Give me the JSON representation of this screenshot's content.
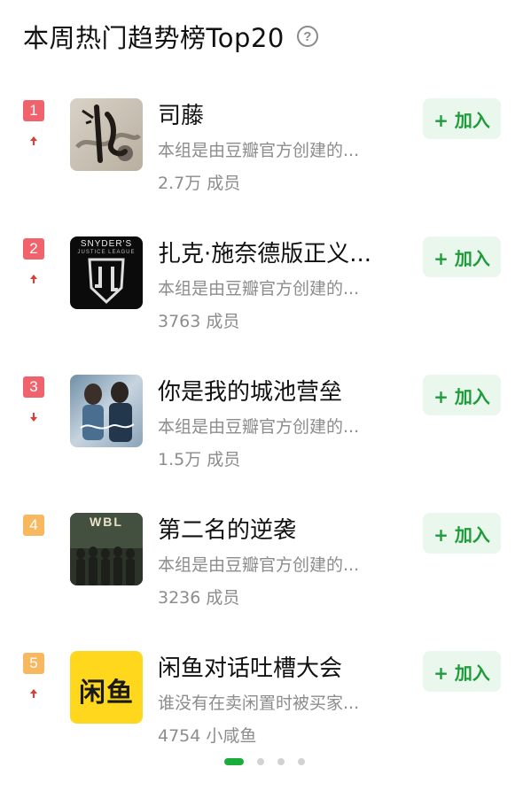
{
  "header": {
    "title": "本周热门趋势榜Top20",
    "help_glyph": "?"
  },
  "groups": [
    {
      "rank": "1",
      "rank_color": "#f0636d",
      "trend": "up",
      "thumbnail": "siteng-poster",
      "name": "司藤",
      "description": "本组是由豆瓣官方创建的...",
      "members": "2.7万 成员",
      "join_label": "+ 加入"
    },
    {
      "rank": "2",
      "rank_color": "#f0636d",
      "trend": "up",
      "thumbnail": "snyder-justice-league-logo",
      "thumb_text_top": "SNYDER'S",
      "thumb_text_sub": "JUSTICE LEAGUE",
      "name": "扎克·施奈德版正义...",
      "description": "本组是由豆瓣官方创建的...",
      "members": "3763 成员",
      "join_label": "+ 加入"
    },
    {
      "rank": "3",
      "rank_color": "#f0636d",
      "trend": "down",
      "thumbnail": "drama-poster",
      "name": "你是我的城池营垒",
      "description": "本组是由豆瓣官方创建的...",
      "members": "1.5万 成员",
      "join_label": "+ 加入"
    },
    {
      "rank": "4",
      "rank_color": "#f7b860",
      "trend": "none",
      "thumbnail": "wbl-poster",
      "thumb_text_top": "WBL",
      "name": "第二名的逆袭",
      "description": "本组是由豆瓣官方创建的...",
      "members": "3236 成员",
      "join_label": "+ 加入"
    },
    {
      "rank": "5",
      "rank_color": "#f7b860",
      "trend": "up",
      "thumbnail": "xianyu-logo",
      "thumb_text_top": "闲鱼",
      "name": "闲鱼对话吐槽大会",
      "description": "谁没有在卖闲置时被买家...",
      "members": "4754 小咸鱼",
      "join_label": "+ 加入"
    }
  ],
  "pagination": {
    "pages": 4,
    "active": 1
  }
}
